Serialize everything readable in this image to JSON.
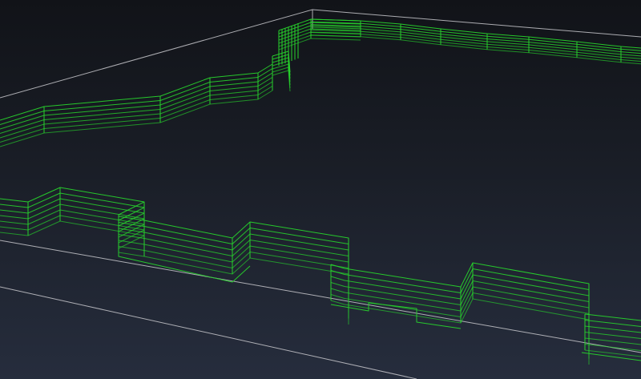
{
  "scene": {
    "background_top": "#111318",
    "background_bottom": "#262d3d",
    "frame_color": "#c8c8cc",
    "wall_color": "#27d12c",
    "wall_layers": 7
  }
}
